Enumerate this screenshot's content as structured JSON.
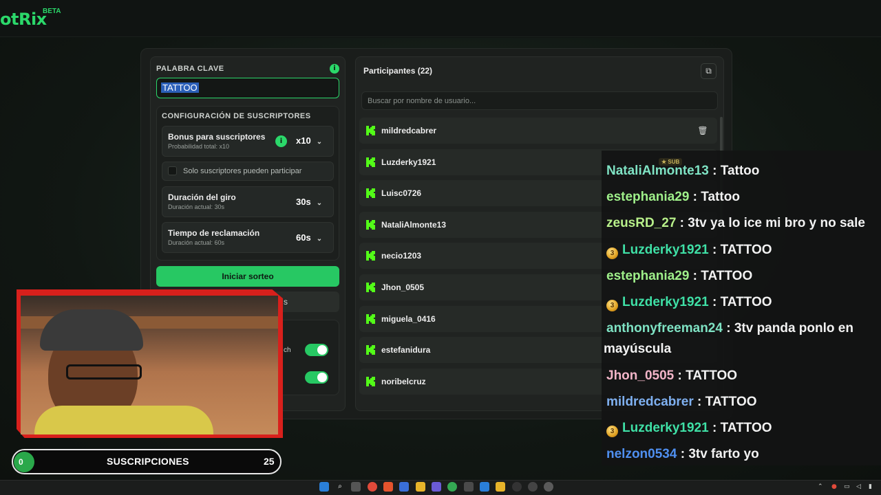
{
  "app": {
    "logo": "otRix",
    "beta": "BETA"
  },
  "config": {
    "keyword_label": "PALABRA CLAVE",
    "keyword_value": "TATTOO",
    "info_glyph": "i",
    "subs_section_title": "CONFIGURACIÓN DE SUSCRIPTORES",
    "bonus": {
      "title": "Bonus para suscriptores",
      "sub": "Probabilidad total: x10",
      "value": "x10"
    },
    "subs_only_label": "Solo suscriptores pueden participar",
    "spin": {
      "title": "Duración del giro",
      "sub": "Duración actual: 30s",
      "value": "30s"
    },
    "claim": {
      "title": "Tiempo de reclamación",
      "sub": "Duración actual: 60s",
      "value": "60s"
    },
    "start_label": "Iniciar sorteo",
    "second_button_fragment": "s",
    "toggle_fragment": "ch",
    "chevron": "⌄"
  },
  "participants": {
    "title": "Participantes (22)",
    "search_placeholder": "Buscar por nombre de usuario...",
    "copy_glyph": "⧉",
    "trash_glyph": "🗑",
    "rows": [
      {
        "name": "mildredcabrer"
      },
      {
        "name": "Luzderky1921"
      },
      {
        "name": "Luisc0726"
      },
      {
        "name": "NataliAlmonte13"
      },
      {
        "name": "necio1203"
      },
      {
        "name": "Jhon_0505"
      },
      {
        "name": "miguela_0416"
      },
      {
        "name": "estefanidura"
      },
      {
        "name": "noribelcruz"
      }
    ]
  },
  "chat": {
    "sub_badge": "★ SUB",
    "badge_digit": "3",
    "messages": [
      {
        "user": "NataliAlmonte13",
        "text": " : Tattoo",
        "color": "#7fe3c4",
        "badge": false
      },
      {
        "user": "estephania29",
        "text": " : Tattoo",
        "color": "#9ff08a",
        "badge": false
      },
      {
        "user": "zeusRD_27",
        "text": " : 3tv ya lo ice mi bro y no sale",
        "color": "#b8f08a",
        "badge": false
      },
      {
        "user": "Luzderky1921",
        "text": " : TATTOO",
        "color": "#3fe0a6",
        "badge": true
      },
      {
        "user": "estephania29",
        "text": " : TATTOO",
        "color": "#9ff08a",
        "badge": false
      },
      {
        "user": "Luzderky1921",
        "text": " : TATTOO",
        "color": "#3fe0a6",
        "badge": true
      },
      {
        "user": "anthonyfreeman24",
        "text": " : 3tv panda ponlo en",
        "color": "#7fe3c4",
        "badge": false
      },
      {
        "user": "",
        "text": "mayúscula",
        "color": "#f2f2f2",
        "badge": false
      },
      {
        "user": "Jhon_0505",
        "text": " : TATTOO",
        "color": "#f2b5c8",
        "badge": false
      },
      {
        "user": "mildredcabrer",
        "text": " : TATTOO",
        "color": "#7fb0f0",
        "badge": false
      },
      {
        "user": "Luzderky1921",
        "text": " : TATTOO",
        "color": "#3fe0a6",
        "badge": true
      },
      {
        "user": "nelzon0534",
        "text": " : 3tv farto yo",
        "color": "#4f8ff0",
        "badge": false
      }
    ]
  },
  "subs_bar": {
    "count": "0",
    "label": "SUSCRIPCIONES",
    "goal": "25"
  },
  "colors": {
    "accent": "#2bd86a",
    "kick_green": "#53fc18",
    "cam_frame": "#d8201c"
  }
}
